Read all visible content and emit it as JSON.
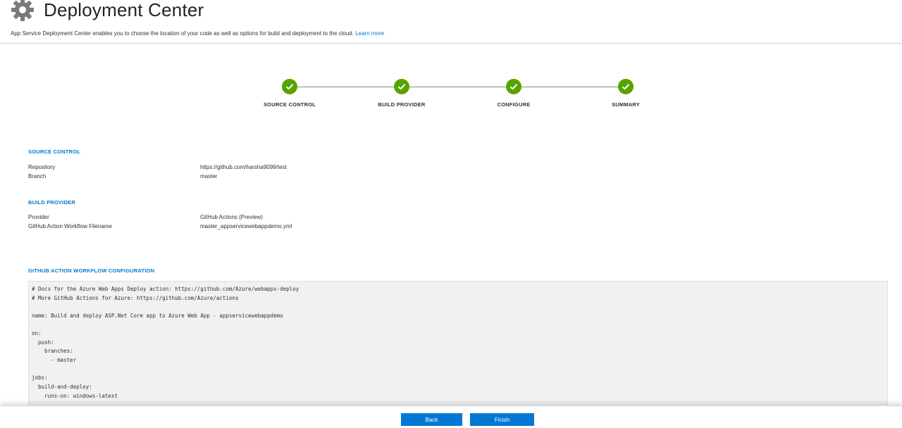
{
  "header": {
    "title": "Deployment Center",
    "description": "App Service Deployment Center enables you to choose the location of your code as well as options for build and deployment to the cloud.",
    "learn_more": "Learn more",
    "icon": "gear-icon"
  },
  "stepper": {
    "status_color": "#57a300",
    "steps": [
      {
        "label": "SOURCE CONTROL",
        "status": "complete"
      },
      {
        "label": "BUILD PROVIDER",
        "status": "complete"
      },
      {
        "label": "CONFIGURE",
        "status": "complete"
      },
      {
        "label": "SUMMARY",
        "status": "complete"
      }
    ]
  },
  "summary": {
    "source_control": {
      "title": "SOURCE CONTROL",
      "rows": [
        {
          "label": "Repository",
          "value": "https://github.com/harsha9099/test"
        },
        {
          "label": "Branch",
          "value": "master"
        }
      ]
    },
    "build_provider": {
      "title": "BUILD PROVIDER",
      "rows": [
        {
          "label": "Provider",
          "value": "GitHub Actions (Preview)"
        },
        {
          "label": "GitHub Action Workflow Filename",
          "value": "master_appservicewebappdemo.yml"
        }
      ]
    },
    "workflow": {
      "title": "GITHUB ACTION WORKFLOW CONFIGURATION",
      "lines": [
        "# Docs for the Azure Web Apps Deploy action: https://github.com/Azure/webapps-deploy",
        "# More GitHub Actions for Azure: https://github.com/Azure/actions",
        "",
        "name: Build and deploy ASP.Net Core app to Azure Web App - appservicewebappdemo",
        "",
        "on:",
        "  push:",
        "    branches:",
        "      - master",
        "",
        "jobs:",
        "  build-and-deploy:",
        "    runs-on: windows-latest"
      ]
    }
  },
  "footer": {
    "back_label": "Back",
    "finish_label": "Finish",
    "accent": "#0078d4"
  }
}
